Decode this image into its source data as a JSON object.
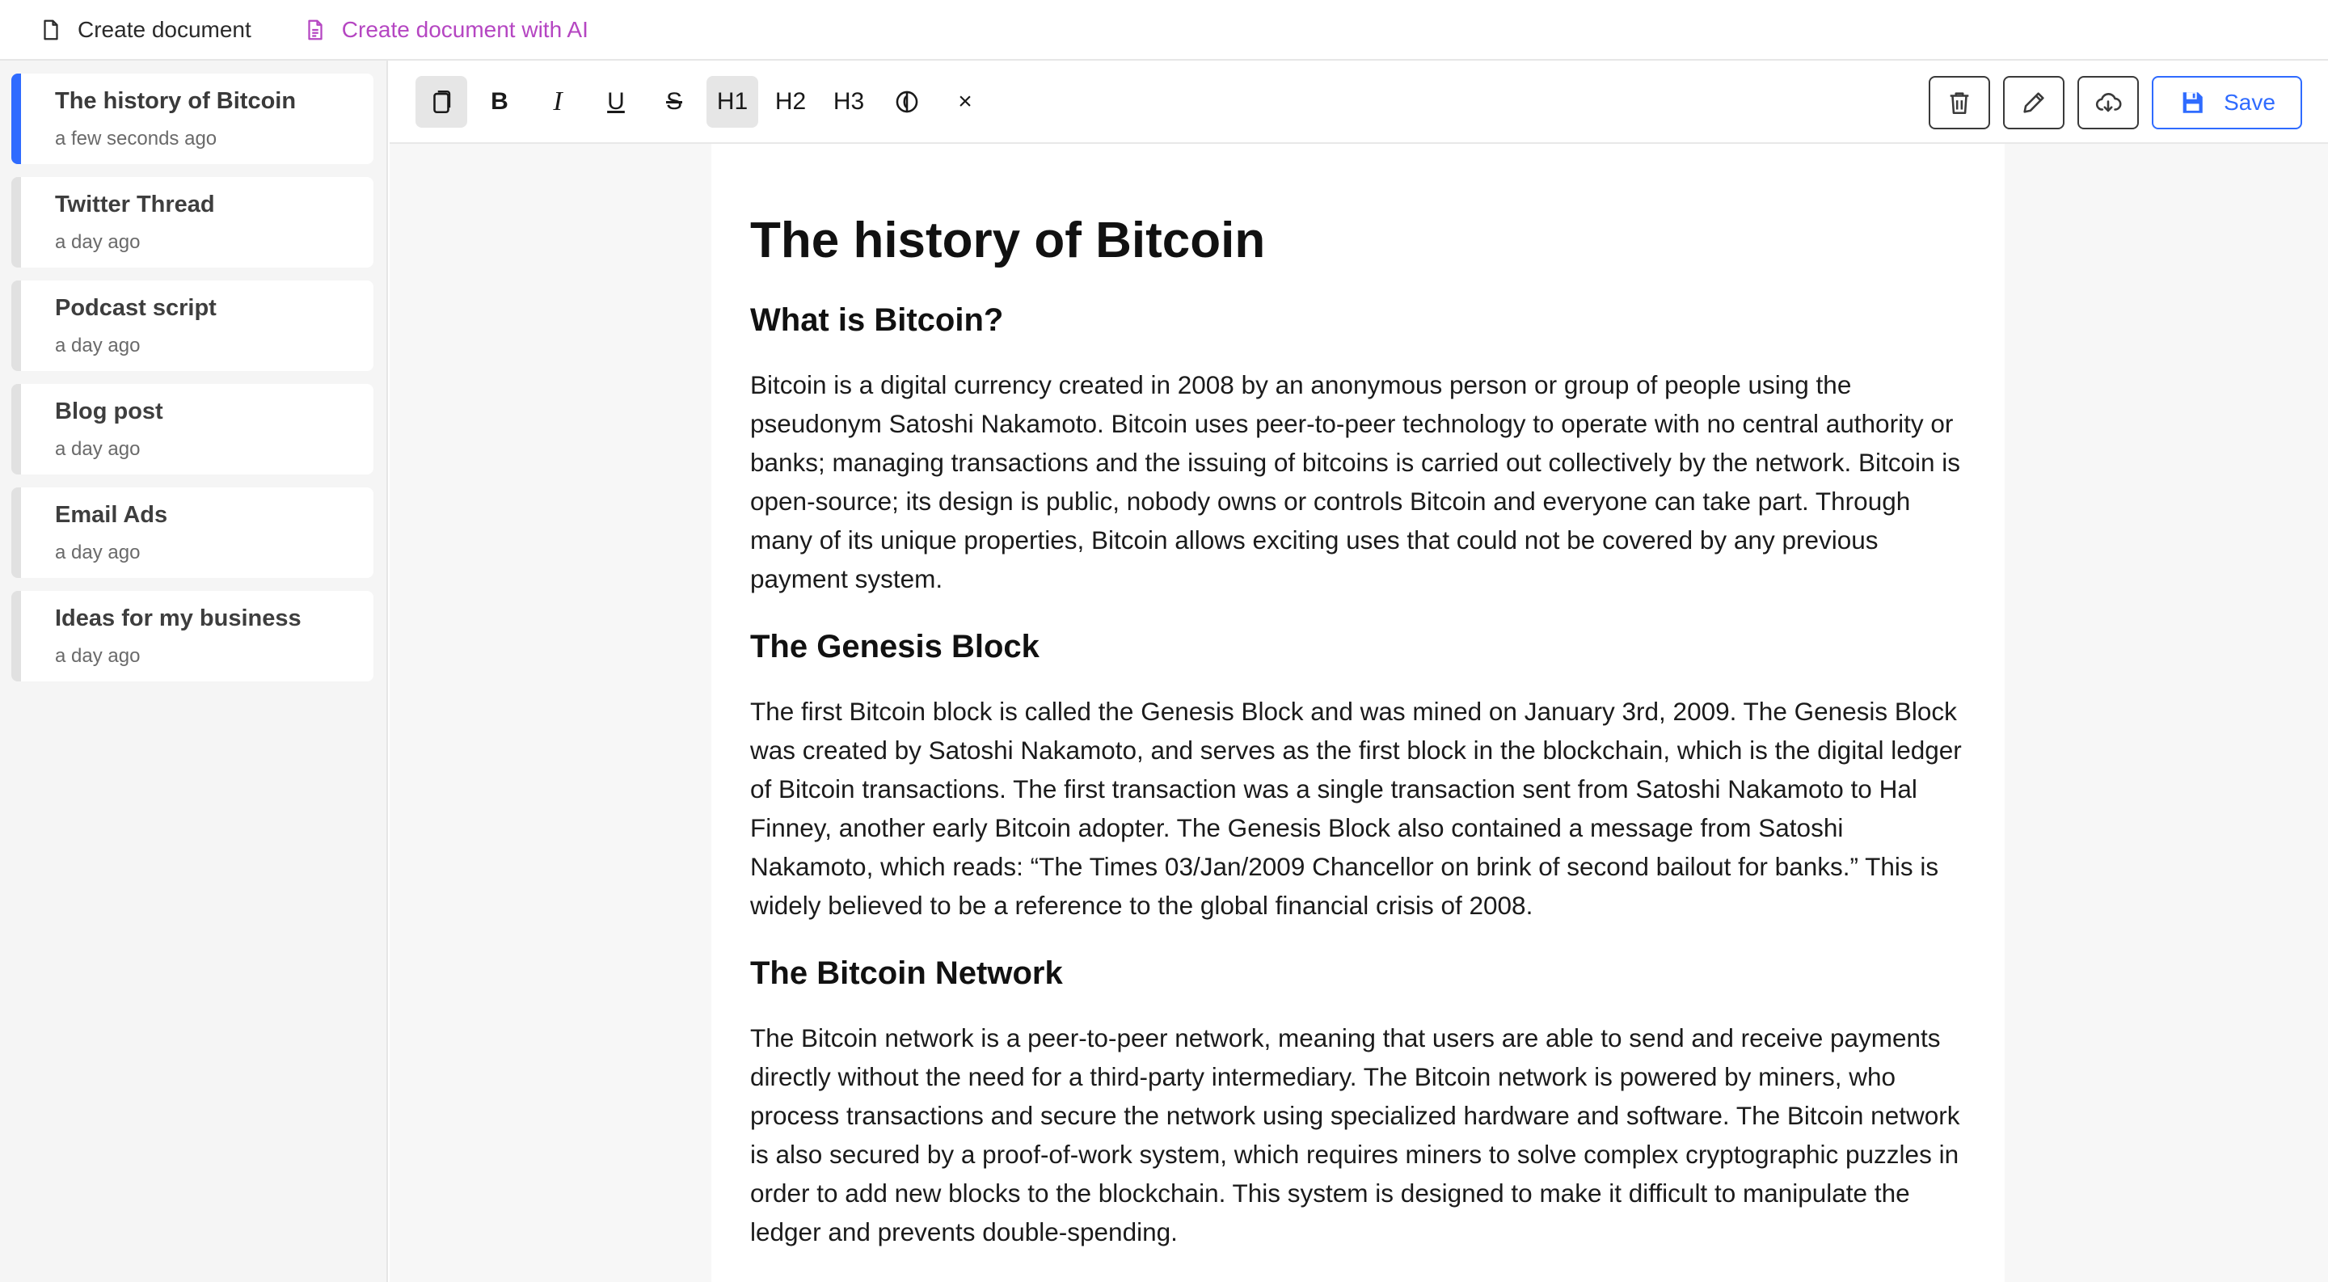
{
  "topbar": {
    "create_document": "Create document",
    "create_document_ai": "Create document with AI"
  },
  "sidebar": {
    "items": [
      {
        "title": "The history of Bitcoin",
        "time": "a few seconds ago",
        "active": true
      },
      {
        "title": "Twitter Thread",
        "time": "a day ago"
      },
      {
        "title": "Podcast script",
        "time": "a day ago"
      },
      {
        "title": "Blog post",
        "time": "a day ago"
      },
      {
        "title": "Email Ads",
        "time": "a day ago"
      },
      {
        "title": "Ideas for my business",
        "time": "a day ago"
      }
    ]
  },
  "toolbar": {
    "bold": "B",
    "italic": "I",
    "underline": "U",
    "strike": "S",
    "h1": "H1",
    "h2": "H2",
    "h3": "H3",
    "clear": "×",
    "save_label": "Save"
  },
  "document": {
    "title": "The history of Bitcoin",
    "sections": [
      {
        "heading": "What is Bitcoin?",
        "body": "Bitcoin is a digital currency created in 2008 by an anonymous person or group of people using the pseudonym Satoshi Nakamoto. Bitcoin uses peer-to-peer technology to operate with no central authority or banks; managing transactions and the issuing of bitcoins is carried out collectively by the network. Bitcoin is open-source; its design is public, nobody owns or controls Bitcoin and everyone can take part. Through many of its unique properties, Bitcoin allows exciting uses that could not be covered by any previous payment system."
      },
      {
        "heading": "The Genesis Block",
        "body": "The first Bitcoin block is called the Genesis Block and was mined on January 3rd, 2009. The Genesis Block was created by Satoshi Nakamoto, and serves as the first block in the blockchain, which is the digital ledger of Bitcoin transactions. The first transaction was a single transaction sent from Satoshi Nakamoto to Hal Finney, another early Bitcoin adopter. The Genesis Block also contained a message from Satoshi Nakamoto, which reads: “The Times 03/Jan/2009 Chancellor on brink of second bailout for banks.” This is widely believed to be a reference to the global financial crisis of 2008."
      },
      {
        "heading": "The Bitcoin Network",
        "body": "The Bitcoin network is a peer-to-peer network, meaning that users are able to send and receive payments directly without the need for a third-party intermediary. The Bitcoin network is powered by miners, who process transactions and secure the network using specialized hardware and software. The Bitcoin network is also secured by a proof-of-work system, which requires miners to solve complex cryptographic puzzles in order to add new blocks to the blockchain. This system is designed to make it difficult to manipulate the ledger and prevents double-spending."
      }
    ]
  },
  "colors": {
    "accent": "#2f6bff",
    "ai": "#b546c2"
  }
}
